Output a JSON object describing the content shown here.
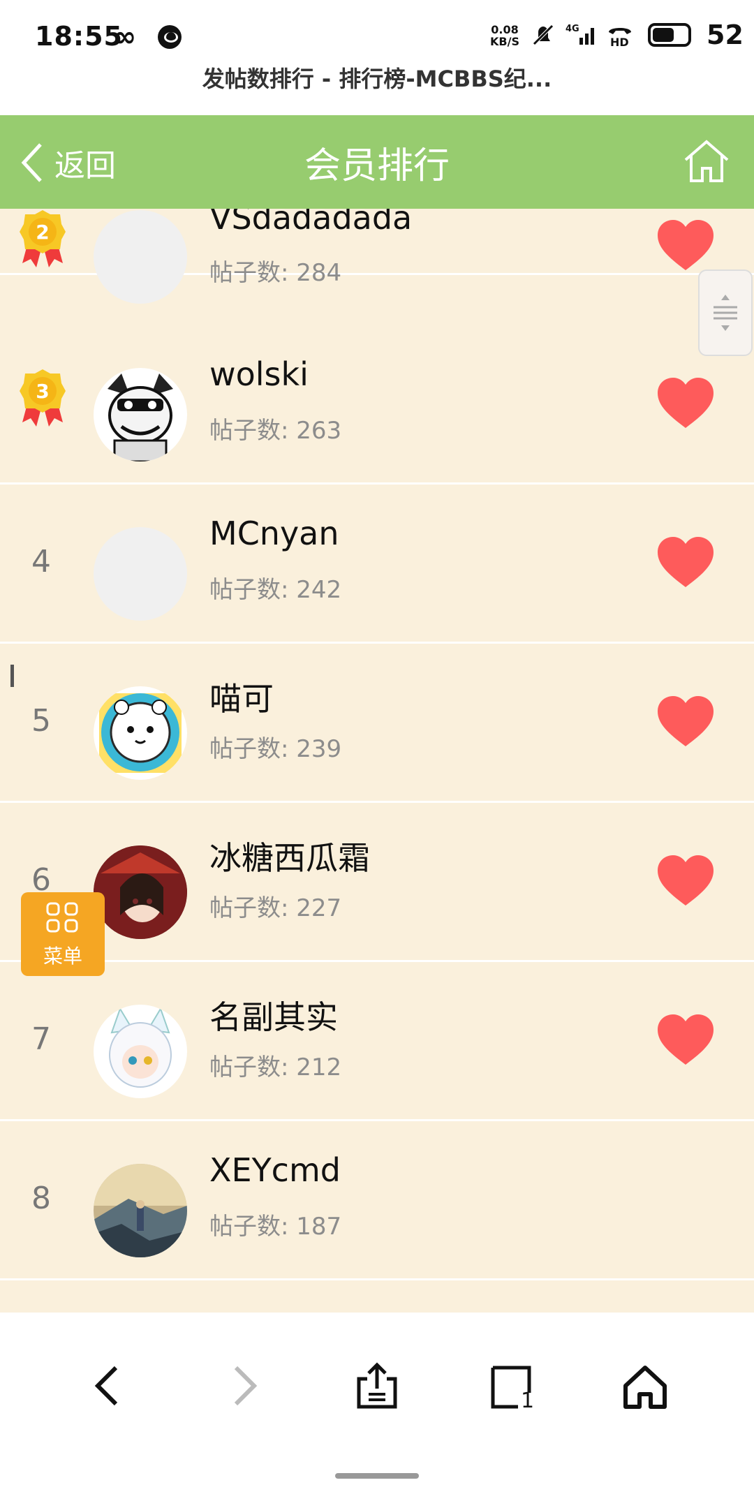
{
  "status_bar": {
    "time": "18:55",
    "speed_value": "0.08",
    "speed_unit": "KB/S",
    "battery": "52"
  },
  "browser": {
    "page_title": "发帖数排行 - 排行榜-MCBBS纪..."
  },
  "header": {
    "back_label": "返回",
    "title": "会员排行"
  },
  "members": [
    {
      "rank": "2",
      "name": "VSdadadada",
      "count": "帖子数: 284",
      "liked": true
    },
    {
      "rank": "3",
      "name": "wolski",
      "count": "帖子数: 263",
      "liked": true
    },
    {
      "rank": "4",
      "name": "MCnyan",
      "count": "帖子数: 242",
      "liked": true
    },
    {
      "rank": "5",
      "name": "喵可",
      "count": "帖子数: 239",
      "liked": true
    },
    {
      "rank": "6",
      "name": "冰糖西瓜霜",
      "count": "帖子数: 227",
      "liked": true
    },
    {
      "rank": "7",
      "name": "名副其实",
      "count": "帖子数: 212",
      "liked": true
    },
    {
      "rank": "8",
      "name": "XEYcmd",
      "count": "帖子数: 187",
      "liked": false
    }
  ],
  "menu_fab": {
    "label": "菜单"
  },
  "bottom_nav": {
    "tabs_count": "1"
  },
  "colors": {
    "header_bg": "#97cc6f",
    "list_bg": "#faf0dc",
    "heart": "#fe5b5b",
    "fab": "#f5a623",
    "medal": "#f7c825"
  }
}
